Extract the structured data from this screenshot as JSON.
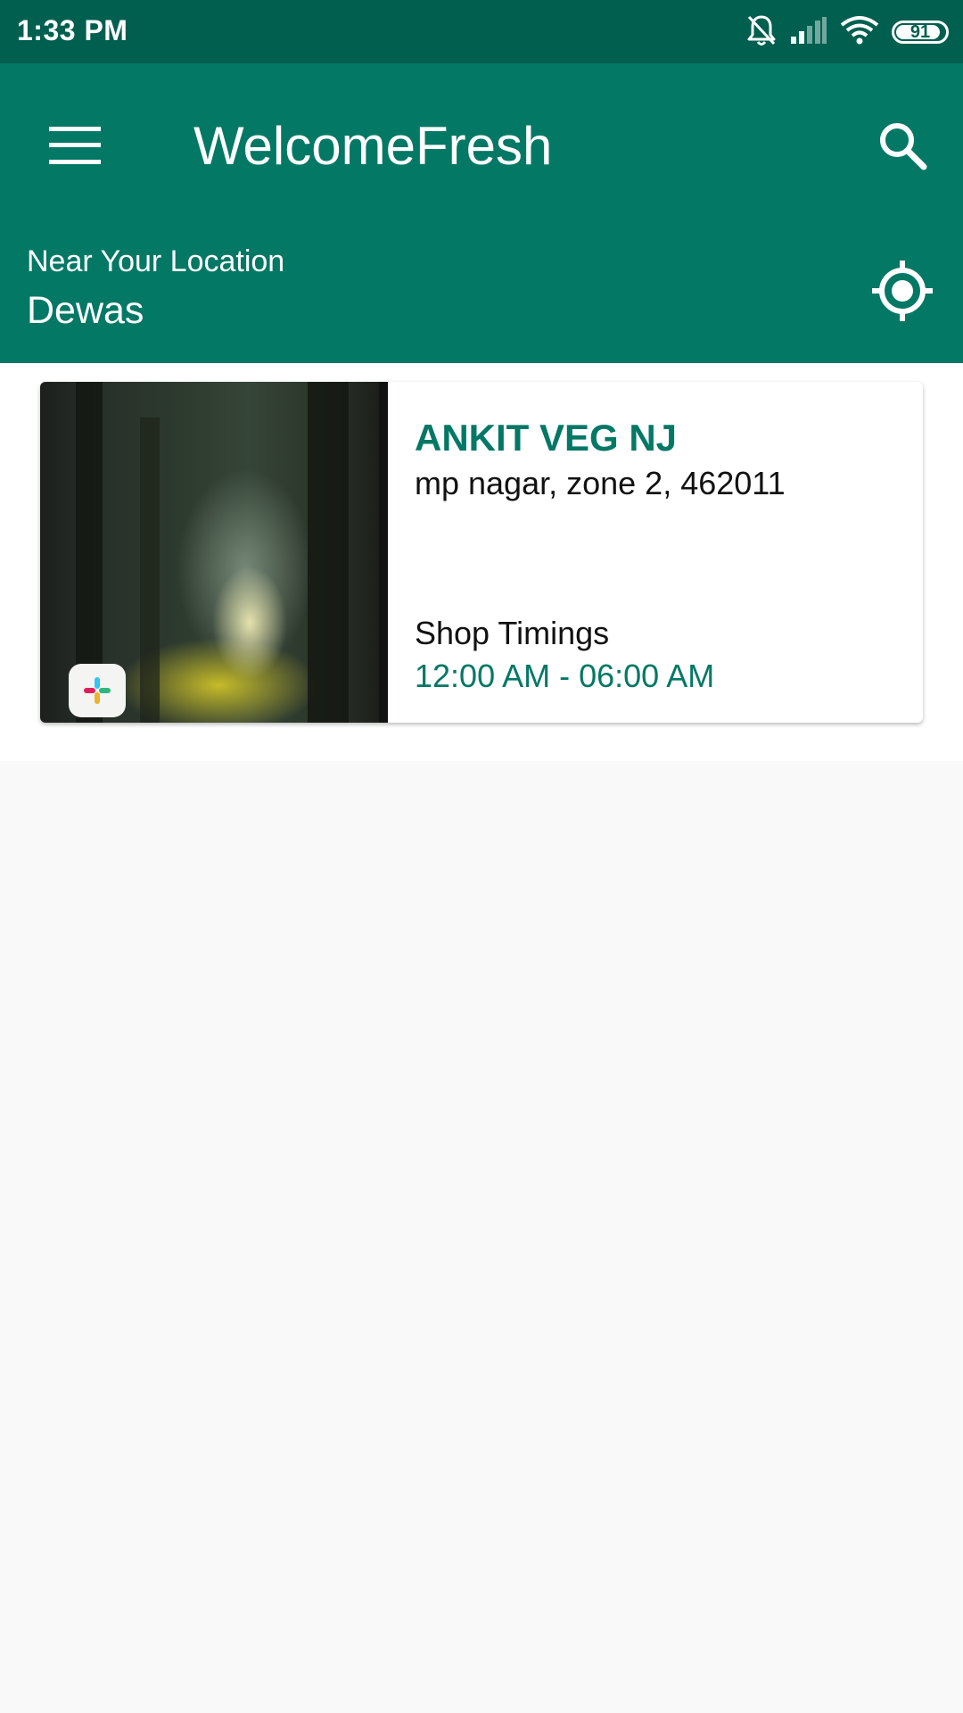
{
  "status_bar": {
    "time": "1:33 PM",
    "battery_level": "91",
    "icons": [
      "bell-off-icon",
      "signal-icon",
      "wifi-icon",
      "battery-icon"
    ]
  },
  "app_bar": {
    "title": "WelcomeFresh",
    "menu_icon": "menu-icon",
    "search_icon": "search-icon"
  },
  "location": {
    "label": "Near Your Location",
    "city": "Dewas",
    "locate_icon": "gps-locate-icon"
  },
  "shops": [
    {
      "name": "ANKIT VEG NJ",
      "address": "mp nagar, zone 2, 462011",
      "timings_label": "Shop Timings",
      "timings": "12:00 AM - 06:00 AM"
    }
  ],
  "colors": {
    "status_bar": "#005f4f",
    "primary": "#037865",
    "background": "#f9f9f9",
    "card": "#ffffff"
  }
}
